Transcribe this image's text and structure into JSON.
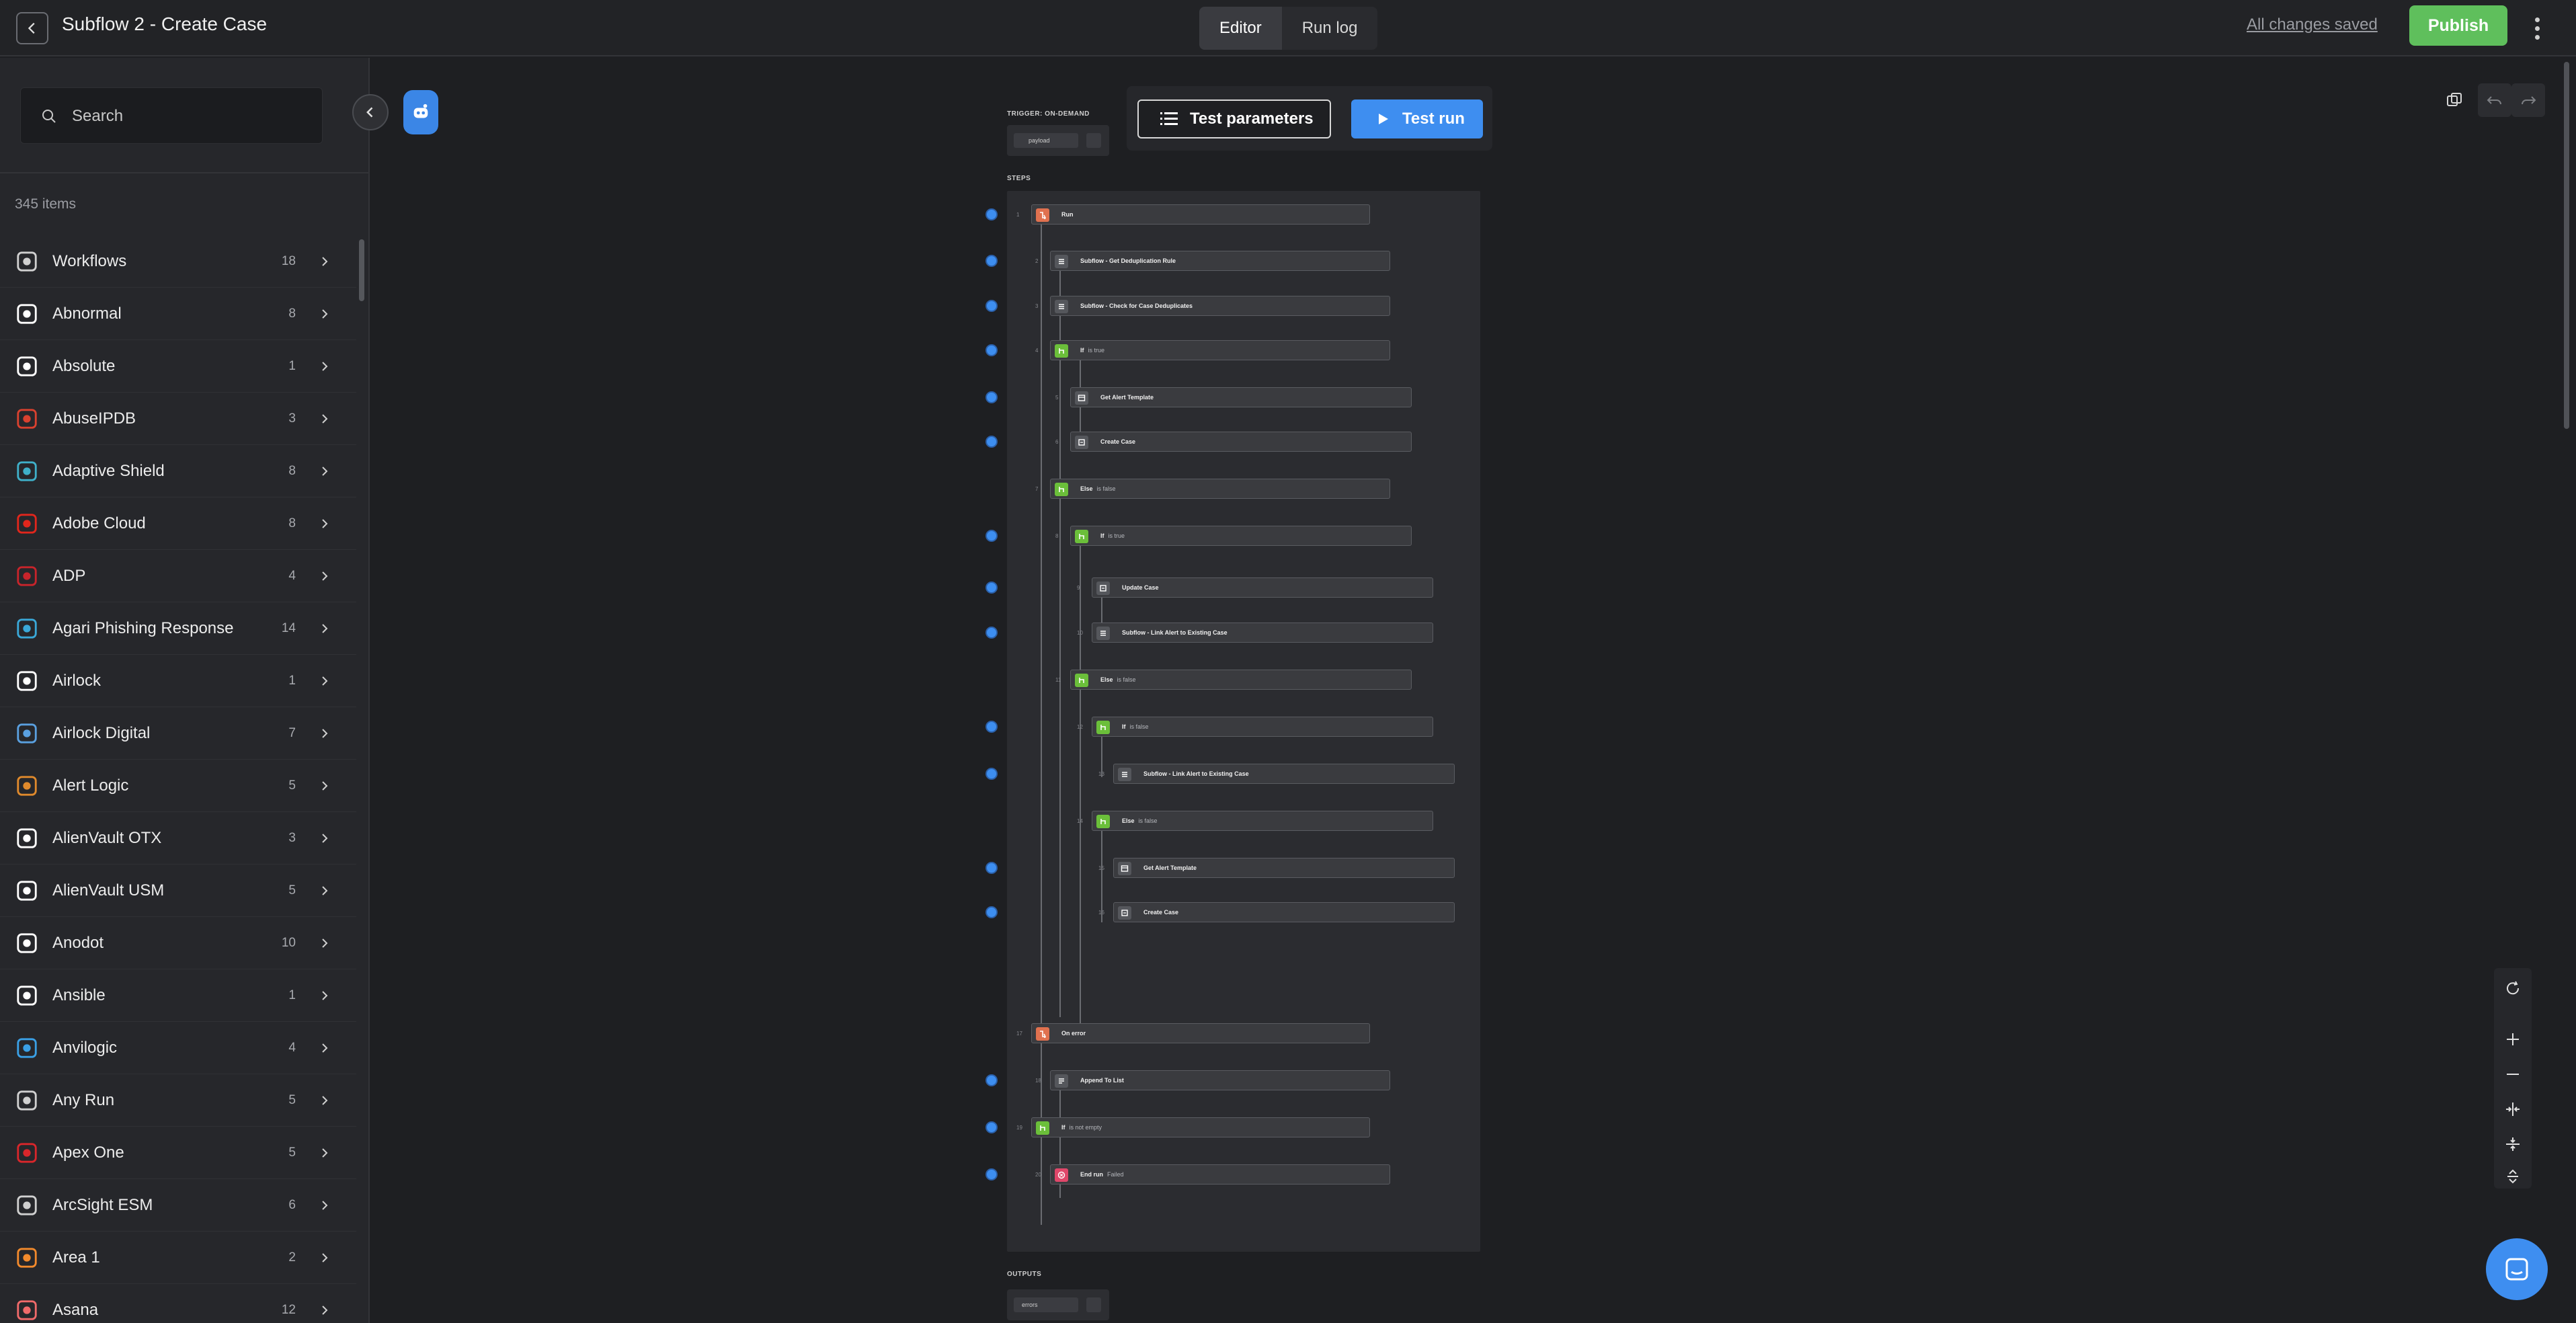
{
  "header": {
    "title": "Subflow 2 - Create Case",
    "tabs": [
      {
        "label": "Editor",
        "active": true
      },
      {
        "label": "Run log",
        "active": false
      }
    ],
    "saved_status": "All changes saved",
    "publish_label": "Publish"
  },
  "sidebar": {
    "search_placeholder": "Search",
    "items_count": "345 items",
    "integrations": [
      {
        "name": "Workflows",
        "count": "18",
        "icon": "workflows-icon",
        "color": "#d0d0d0"
      },
      {
        "name": "Abnormal",
        "count": "8",
        "icon": "abnormal-logo-icon",
        "color": "#ffffff"
      },
      {
        "name": "Absolute",
        "count": "1",
        "icon": "absolute-logo-icon",
        "color": "#ffffff"
      },
      {
        "name": "AbuseIPDB",
        "count": "3",
        "icon": "abuseipdb-logo-icon",
        "color": "#d9412f"
      },
      {
        "name": "Adaptive Shield",
        "count": "8",
        "icon": "adaptive-shield-logo-icon",
        "color": "#3fb0c9"
      },
      {
        "name": "Adobe Cloud",
        "count": "8",
        "icon": "adobe-cloud-logo-icon",
        "color": "#e1261c"
      },
      {
        "name": "ADP",
        "count": "4",
        "icon": "adp-logo-icon",
        "color": "#c8242b"
      },
      {
        "name": "Agari Phishing Response",
        "count": "14",
        "icon": "agari-logo-icon",
        "color": "#3aa8d8"
      },
      {
        "name": "Airlock",
        "count": "1",
        "icon": "airlock-logo-icon",
        "color": "#ffffff"
      },
      {
        "name": "Airlock Digital",
        "count": "7",
        "icon": "airlock-digital-logo-icon",
        "color": "#5aa0e0"
      },
      {
        "name": "Alert Logic",
        "count": "5",
        "icon": "alert-logic-logo-icon",
        "color": "#e08a2c"
      },
      {
        "name": "AlienVault OTX",
        "count": "3",
        "icon": "alienvault-otx-logo-icon",
        "color": "#ffffff"
      },
      {
        "name": "AlienVault USM",
        "count": "5",
        "icon": "alienvault-usm-logo-icon",
        "color": "#ffffff"
      },
      {
        "name": "Anodot",
        "count": "10",
        "icon": "anodot-logo-icon",
        "color": "#ffffff"
      },
      {
        "name": "Ansible",
        "count": "1",
        "icon": "ansible-logo-icon",
        "color": "#ffffff"
      },
      {
        "name": "Anvilogic",
        "count": "4",
        "icon": "anvilogic-logo-icon",
        "color": "#3aa0e6"
      },
      {
        "name": "Any Run",
        "count": "5",
        "icon": "any-run-logo-icon",
        "color": "#d0d0d0"
      },
      {
        "name": "Apex One",
        "count": "5",
        "icon": "apex-one-logo-icon",
        "color": "#d9262b"
      },
      {
        "name": "ArcSight ESM",
        "count": "6",
        "icon": "arcsight-logo-icon",
        "color": "#d0d0d0"
      },
      {
        "name": "Area 1",
        "count": "2",
        "icon": "area1-logo-icon",
        "color": "#f28a2c"
      },
      {
        "name": "Asana",
        "count": "12",
        "icon": "asana-logo-icon",
        "color": "#f06a6a"
      }
    ]
  },
  "canvas": {
    "trigger_label": "TRIGGER: ON-DEMAND",
    "trigger_chip": "payload",
    "steps_label": "STEPS",
    "outputs_label": "OUTPUTS",
    "outputs_chip": "errors",
    "test_parameters_label": "Test parameters",
    "test_run_label": "Test run",
    "steps": [
      {
        "num": "1",
        "label": "Run",
        "cond": "",
        "icon": "run-icon",
        "color": "#e0714f",
        "dot": true
      },
      {
        "num": "2",
        "label": "Subflow - Get Deduplication Rule",
        "cond": "",
        "icon": "subflow-icon",
        "color": "#55575c",
        "dot": true
      },
      {
        "num": "3",
        "label": "Subflow - Check for Case Deduplicates",
        "cond": "",
        "icon": "subflow-icon",
        "color": "#55575c",
        "dot": true
      },
      {
        "num": "4",
        "label": "If",
        "cond": "is true",
        "icon": "branch-icon",
        "color": "#6bbf3a",
        "dot": true
      },
      {
        "num": "5",
        "label": "Get Alert Template",
        "cond": "",
        "icon": "template-icon",
        "color": "#55575c",
        "dot": true
      },
      {
        "num": "6",
        "label": "Create Case",
        "cond": "",
        "icon": "case-icon",
        "color": "#55575c",
        "dot": true
      },
      {
        "num": "7",
        "label": "Else",
        "cond": "is false",
        "icon": "branch-icon",
        "color": "#6bbf3a",
        "dot": false
      },
      {
        "num": "8",
        "label": "If",
        "cond": "is true",
        "icon": "branch-icon",
        "color": "#6bbf3a",
        "dot": true
      },
      {
        "num": "9",
        "label": "Update Case",
        "cond": "",
        "icon": "case-icon",
        "color": "#55575c",
        "dot": true
      },
      {
        "num": "10",
        "label": "Subflow - Link Alert to Existing Case",
        "cond": "",
        "icon": "subflow-icon",
        "color": "#55575c",
        "dot": true
      },
      {
        "num": "11",
        "label": "Else",
        "cond": "is false",
        "icon": "branch-icon",
        "color": "#6bbf3a",
        "dot": false
      },
      {
        "num": "12",
        "label": "If",
        "cond": "is false",
        "icon": "branch-icon",
        "color": "#6bbf3a",
        "dot": true
      },
      {
        "num": "13",
        "label": "Subflow - Link Alert to Existing Case",
        "cond": "",
        "icon": "subflow-icon",
        "color": "#55575c",
        "dot": true
      },
      {
        "num": "14",
        "label": "Else",
        "cond": "is false",
        "icon": "branch-icon",
        "color": "#6bbf3a",
        "dot": false
      },
      {
        "num": "15",
        "label": "Get Alert Template",
        "cond": "",
        "icon": "template-icon",
        "color": "#55575c",
        "dot": true
      },
      {
        "num": "16",
        "label": "Create Case",
        "cond": "",
        "icon": "case-icon",
        "color": "#55575c",
        "dot": true
      },
      {
        "num": "17",
        "label": "On error",
        "cond": "",
        "icon": "run-icon",
        "color": "#e0714f",
        "dot": false
      },
      {
        "num": "18",
        "label": "Append To List",
        "cond": "",
        "icon": "list-icon",
        "color": "#55575c",
        "dot": true
      },
      {
        "num": "19",
        "label": "If",
        "cond": "is not empty",
        "icon": "branch-icon",
        "color": "#6bbf3a",
        "dot": true
      },
      {
        "num": "20",
        "label": "End run",
        "cond": "Failed",
        "icon": "end-run-icon",
        "color": "#e0476a",
        "dot": true
      }
    ]
  }
}
